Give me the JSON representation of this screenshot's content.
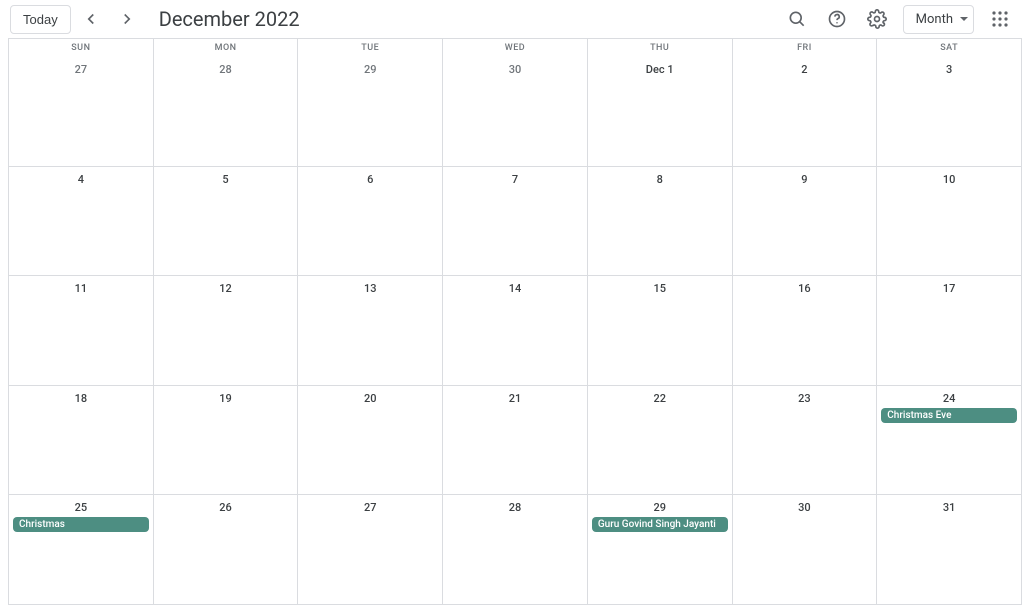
{
  "header": {
    "today": "Today",
    "title": "December 2022",
    "view": "Month"
  },
  "dayHeaders": [
    "SUN",
    "MON",
    "TUE",
    "WED",
    "THU",
    "FRI",
    "SAT"
  ],
  "weeks": [
    [
      {
        "label": "27",
        "other": true,
        "events": []
      },
      {
        "label": "28",
        "other": true,
        "events": []
      },
      {
        "label": "29",
        "other": true,
        "events": []
      },
      {
        "label": "30",
        "other": true,
        "events": []
      },
      {
        "label": "Dec 1",
        "other": false,
        "events": []
      },
      {
        "label": "2",
        "other": false,
        "events": []
      },
      {
        "label": "3",
        "other": false,
        "events": []
      }
    ],
    [
      {
        "label": "4",
        "other": false,
        "events": []
      },
      {
        "label": "5",
        "other": false,
        "events": []
      },
      {
        "label": "6",
        "other": false,
        "events": []
      },
      {
        "label": "7",
        "other": false,
        "events": []
      },
      {
        "label": "8",
        "other": false,
        "events": []
      },
      {
        "label": "9",
        "other": false,
        "events": []
      },
      {
        "label": "10",
        "other": false,
        "events": []
      }
    ],
    [
      {
        "label": "11",
        "other": false,
        "events": []
      },
      {
        "label": "12",
        "other": false,
        "events": []
      },
      {
        "label": "13",
        "other": false,
        "events": []
      },
      {
        "label": "14",
        "other": false,
        "events": []
      },
      {
        "label": "15",
        "other": false,
        "events": []
      },
      {
        "label": "16",
        "other": false,
        "events": []
      },
      {
        "label": "17",
        "other": false,
        "events": []
      }
    ],
    [
      {
        "label": "18",
        "other": false,
        "events": []
      },
      {
        "label": "19",
        "other": false,
        "events": []
      },
      {
        "label": "20",
        "other": false,
        "events": []
      },
      {
        "label": "21",
        "other": false,
        "events": []
      },
      {
        "label": "22",
        "other": false,
        "events": []
      },
      {
        "label": "23",
        "other": false,
        "events": []
      },
      {
        "label": "24",
        "other": false,
        "events": [
          "Christmas Eve"
        ]
      }
    ],
    [
      {
        "label": "25",
        "other": false,
        "events": [
          "Christmas"
        ]
      },
      {
        "label": "26",
        "other": false,
        "events": []
      },
      {
        "label": "27",
        "other": false,
        "events": []
      },
      {
        "label": "28",
        "other": false,
        "events": []
      },
      {
        "label": "29",
        "other": false,
        "events": [
          "Guru Govind Singh Jayanti"
        ]
      },
      {
        "label": "30",
        "other": false,
        "events": []
      },
      {
        "label": "31",
        "other": false,
        "events": []
      }
    ]
  ]
}
